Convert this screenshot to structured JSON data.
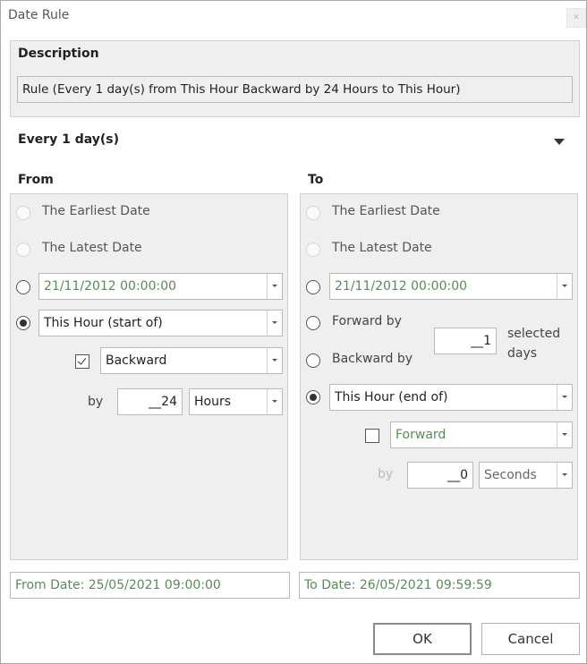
{
  "window": {
    "title": "Date Rule"
  },
  "description": {
    "heading": "Description",
    "text": "Rule (Every 1 day(s) from This Hour Backward by 24 Hours to This Hour)"
  },
  "recurrence": {
    "label": "Every 1 day(s)"
  },
  "from": {
    "heading": "From",
    "earliest": "The Earliest Date",
    "latest": "The Latest Date",
    "date_value": "21/11/2012 00:00:00",
    "relative_value": "This Hour (start of)",
    "direction_checked": true,
    "direction_value": "Backward",
    "by_label": "by",
    "by_amount": "__24",
    "by_unit": "Hours",
    "result": "From Date: 25/05/2021 09:00:00"
  },
  "to": {
    "heading": "To",
    "earliest": "The Earliest Date",
    "latest": "The Latest Date",
    "date_value": "21/11/2012 00:00:00",
    "forward_by": "Forward by",
    "backward_by": "Backward by",
    "days_amount": "__1",
    "days_label": "selected days",
    "relative_value": "This Hour (end of)",
    "direction_checked": false,
    "direction_value": "Forward",
    "by_label": "by",
    "by_amount": "__0",
    "by_unit": "Seconds",
    "result": "To Date: 26/05/2021 09:59:59"
  },
  "buttons": {
    "ok": "OK",
    "cancel": "Cancel"
  },
  "icons": {
    "close": "close-icon",
    "expand": "chevron-down-icon",
    "dropdown": "dropdown-arrow-icon",
    "check": "checkmark-icon"
  }
}
